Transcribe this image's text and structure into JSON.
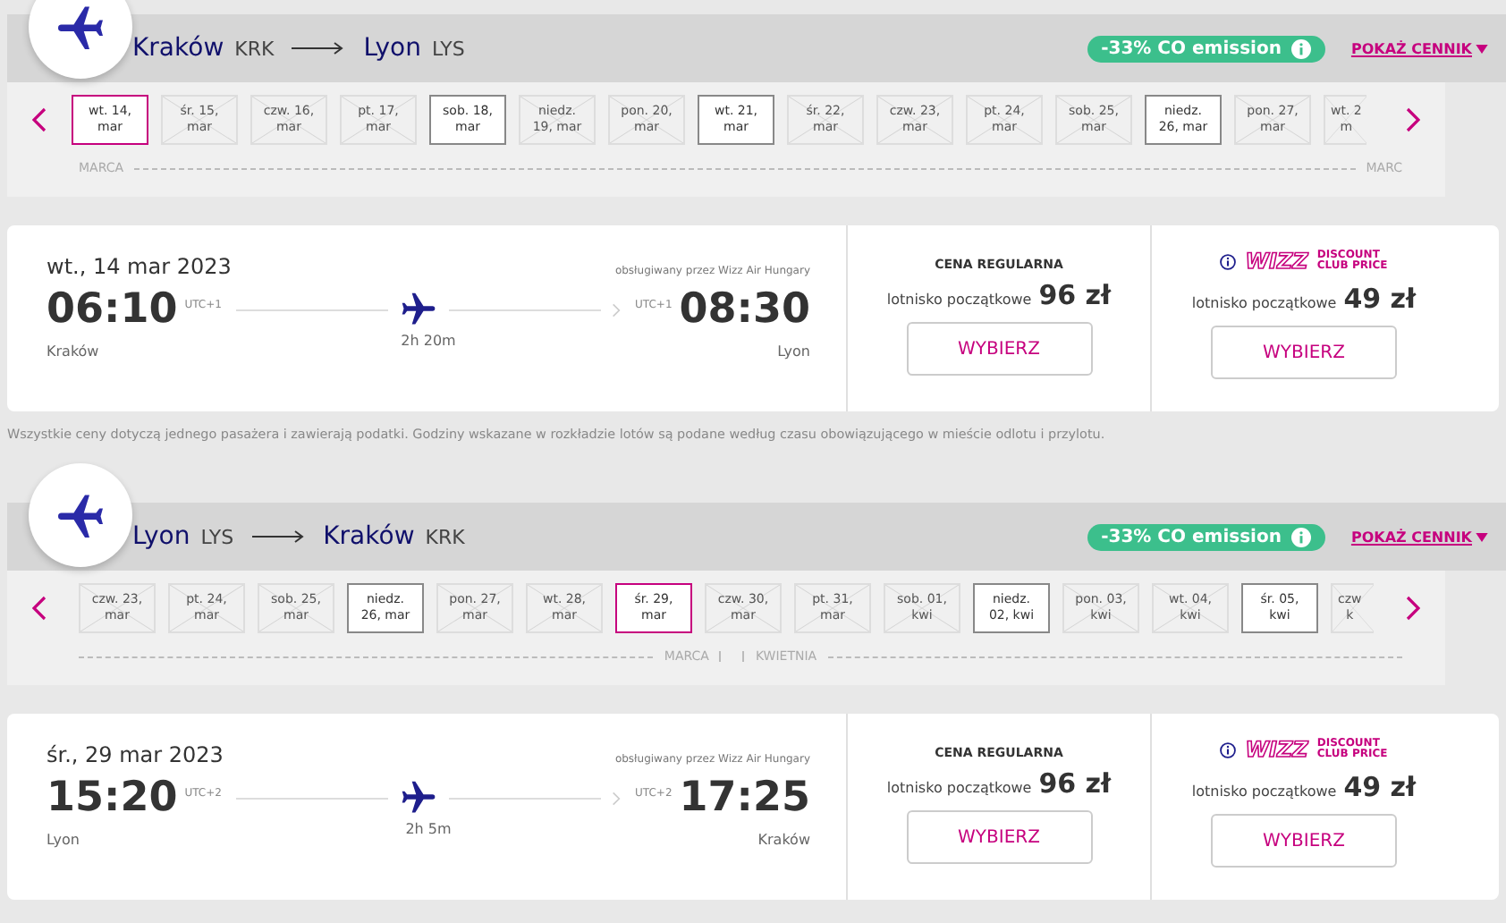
{
  "legs": [
    {
      "from_city": "Kraków",
      "from_code": "KRK",
      "to_city": "Lyon",
      "to_code": "LYS",
      "emission_badge": "-33% CO emission",
      "price_link": "POKAŻ CENNIK",
      "dates": [
        {
          "line1": "wt. 14,",
          "line2": "mar",
          "available": true,
          "selected": true
        },
        {
          "line1": "śr. 15,",
          "line2": "mar",
          "available": false,
          "selected": false
        },
        {
          "line1": "czw. 16,",
          "line2": "mar",
          "available": false,
          "selected": false
        },
        {
          "line1": "pt. 17,",
          "line2": "mar",
          "available": false,
          "selected": false
        },
        {
          "line1": "sob. 18,",
          "line2": "mar",
          "available": true,
          "selected": false
        },
        {
          "line1": "niedz.",
          "line2": "19, mar",
          "available": false,
          "selected": false
        },
        {
          "line1": "pon. 20,",
          "line2": "mar",
          "available": false,
          "selected": false
        },
        {
          "line1": "wt. 21,",
          "line2": "mar",
          "available": true,
          "selected": false
        },
        {
          "line1": "śr. 22,",
          "line2": "mar",
          "available": false,
          "selected": false
        },
        {
          "line1": "czw. 23,",
          "line2": "mar",
          "available": false,
          "selected": false
        },
        {
          "line1": "pt. 24,",
          "line2": "mar",
          "available": false,
          "selected": false
        },
        {
          "line1": "sob. 25,",
          "line2": "mar",
          "available": false,
          "selected": false
        },
        {
          "line1": "niedz.",
          "line2": "26, mar",
          "available": true,
          "selected": false
        },
        {
          "line1": "pon. 27,",
          "line2": "mar",
          "available": false,
          "selected": false
        },
        {
          "line1": "wt. 2",
          "line2": "m",
          "available": false,
          "selected": false
        }
      ],
      "months": [
        "MARCA",
        "MARC"
      ],
      "flight": {
        "date": "wt., 14 mar 2023",
        "operator": "obsługiwany przez Wizz Air Hungary",
        "dep_time": "06:10",
        "dep_tz": "UTC+1",
        "arr_time": "08:30",
        "arr_tz": "UTC+1",
        "dep_city": "Kraków",
        "arr_city": "Lyon",
        "duration": "2h 20m"
      },
      "regular": {
        "title": "CENA REGULARNA",
        "label": "lotnisko początkowe",
        "price": "96 zł",
        "button": "WYBIERZ"
      },
      "club": {
        "logo_main": "WIZZ",
        "logo_line1": "DISCOUNT",
        "logo_line2": "CLUB PRICE",
        "label": "lotnisko początkowe",
        "price": "49 zł",
        "button": "WYBIERZ"
      },
      "note": "Wszystkie ceny dotyczą jednego pasażera i zawierają podatki. Godziny wskazane w rozkładzie lotów są podane według czasu obowiązującego w mieście odlotu i przylotu."
    },
    {
      "from_city": "Lyon",
      "from_code": "LYS",
      "to_city": "Kraków",
      "to_code": "KRK",
      "emission_badge": "-33% CO emission",
      "price_link": "POKAŻ CENNIK",
      "dates": [
        {
          "line1": "czw. 23,",
          "line2": "mar",
          "available": false,
          "selected": false
        },
        {
          "line1": "pt. 24,",
          "line2": "mar",
          "available": false,
          "selected": false
        },
        {
          "line1": "sob. 25,",
          "line2": "mar",
          "available": false,
          "selected": false
        },
        {
          "line1": "niedz.",
          "line2": "26, mar",
          "available": true,
          "selected": false
        },
        {
          "line1": "pon. 27,",
          "line2": "mar",
          "available": false,
          "selected": false
        },
        {
          "line1": "wt. 28,",
          "line2": "mar",
          "available": false,
          "selected": false
        },
        {
          "line1": "śr. 29,",
          "line2": "mar",
          "available": true,
          "selected": true
        },
        {
          "line1": "czw. 30,",
          "line2": "mar",
          "available": false,
          "selected": false
        },
        {
          "line1": "pt. 31,",
          "line2": "mar",
          "available": false,
          "selected": false
        },
        {
          "line1": "sob. 01,",
          "line2": "kwi",
          "available": false,
          "selected": false
        },
        {
          "line1": "niedz.",
          "line2": "02, kwi",
          "available": true,
          "selected": false
        },
        {
          "line1": "pon. 03,",
          "line2": "kwi",
          "available": false,
          "selected": false
        },
        {
          "line1": "wt. 04,",
          "line2": "kwi",
          "available": false,
          "selected": false
        },
        {
          "line1": "śr. 05,",
          "line2": "kwi",
          "available": true,
          "selected": false
        },
        {
          "line1": "czw",
          "line2": "k",
          "available": false,
          "selected": false
        }
      ],
      "months": [
        "MARCA",
        "KWIETNIA"
      ],
      "flight": {
        "date": "śr., 29 mar 2023",
        "operator": "obsługiwany przez Wizz Air Hungary",
        "dep_time": "15:20",
        "dep_tz": "UTC+2",
        "arr_time": "17:25",
        "arr_tz": "UTC+2",
        "dep_city": "Lyon",
        "arr_city": "Kraków",
        "duration": "2h 5m"
      },
      "regular": {
        "title": "CENA REGULARNA",
        "label": "lotnisko początkowe",
        "price": "96 zł",
        "button": "WYBIERZ"
      },
      "club": {
        "logo_main": "WIZZ",
        "logo_line1": "DISCOUNT",
        "logo_line2": "CLUB PRICE",
        "label": "lotnisko początkowe",
        "price": "49 zł",
        "button": "WYBIERZ"
      }
    }
  ]
}
